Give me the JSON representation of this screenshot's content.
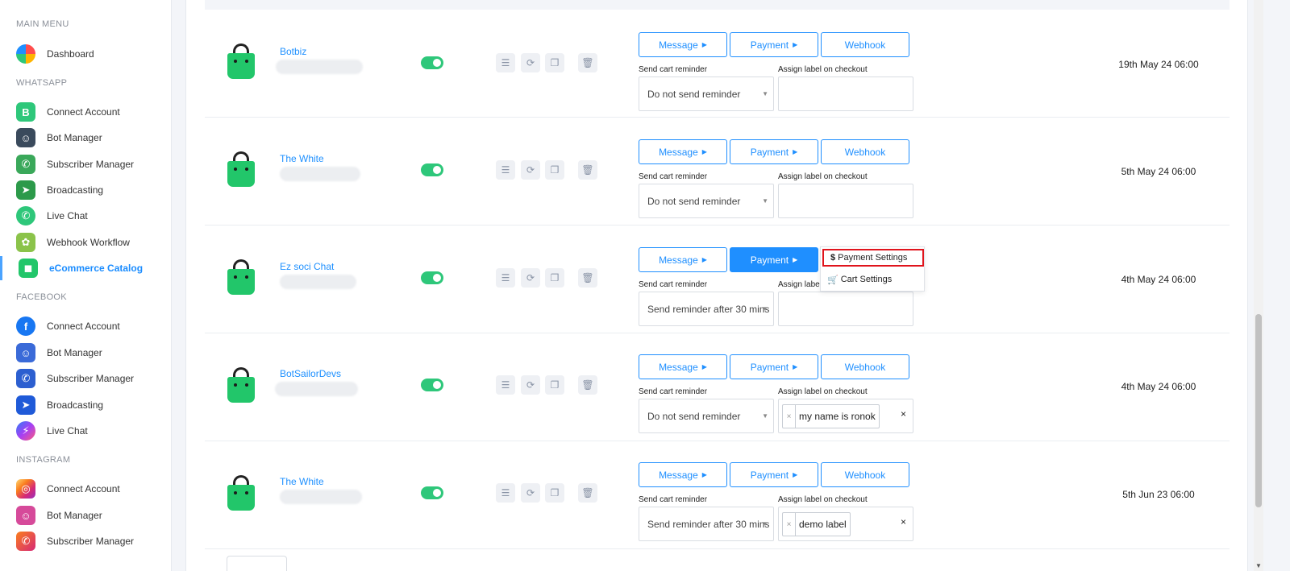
{
  "sidebar": {
    "sections": {
      "main": "MAIN MENU",
      "whatsapp": "WHATSAPP",
      "facebook": "FACEBOOK",
      "instagram": "INSTAGRAM"
    },
    "items": {
      "dashboard": "Dashboard",
      "wa_connect": "Connect Account",
      "wa_bot": "Bot Manager",
      "wa_subscriber": "Subscriber Manager",
      "wa_broadcast": "Broadcasting",
      "wa_livechat": "Live Chat",
      "wa_webhook": "Webhook Workflow",
      "wa_ecommerce": "eCommerce Catalog",
      "fb_connect": "Connect Account",
      "fb_bot": "Bot Manager",
      "fb_subscriber": "Subscriber Manager",
      "fb_broadcast": "Broadcasting",
      "fb_livechat": "Live Chat",
      "ig_connect": "Connect Account",
      "ig_bot": "Bot Manager",
      "ig_subscriber": "Subscriber Manager"
    },
    "active_item": "eCommerce Catalog"
  },
  "common": {
    "message_btn": "Message",
    "payment_btn": "Payment",
    "webhook_btn": "Webhook",
    "send_reminder_label": "Send cart reminder",
    "assign_label": "Assign label on checkout",
    "assign_label_short": "Assign label",
    "chip_remove": "×",
    "clear": "×"
  },
  "rows": [
    {
      "name": "Botbiz",
      "enabled": true,
      "reminder": "Do not send reminder",
      "labels": [],
      "date": "19th May 24 06:00"
    },
    {
      "name": "The White",
      "enabled": true,
      "reminder": "Do not send reminder",
      "labels": [],
      "date": "5th May 24 06:00"
    },
    {
      "name": "Ez soci Chat",
      "enabled": true,
      "reminder": "Send reminder after 30 mins",
      "labels": [],
      "date": "4th May 24 06:00",
      "payment_menu_open": true
    },
    {
      "name": "BotSailorDevs",
      "enabled": true,
      "reminder": "Do not send reminder",
      "labels": [
        "my name is ronok"
      ],
      "date": "4th May 24 06:00"
    },
    {
      "name": "The White",
      "enabled": true,
      "reminder": "Send reminder after 30 mins",
      "labels": [
        "demo label"
      ],
      "date": "5th Jun 23 06:00"
    }
  ],
  "payment_dropdown": {
    "items": [
      "Payment Settings",
      "Cart Settings"
    ],
    "highlighted": "Payment Settings"
  },
  "colors": {
    "accent": "#1f8fff",
    "toggle_on": "#2ec77a",
    "bag": "#22c66a",
    "highlight_box": "#e0141c"
  }
}
